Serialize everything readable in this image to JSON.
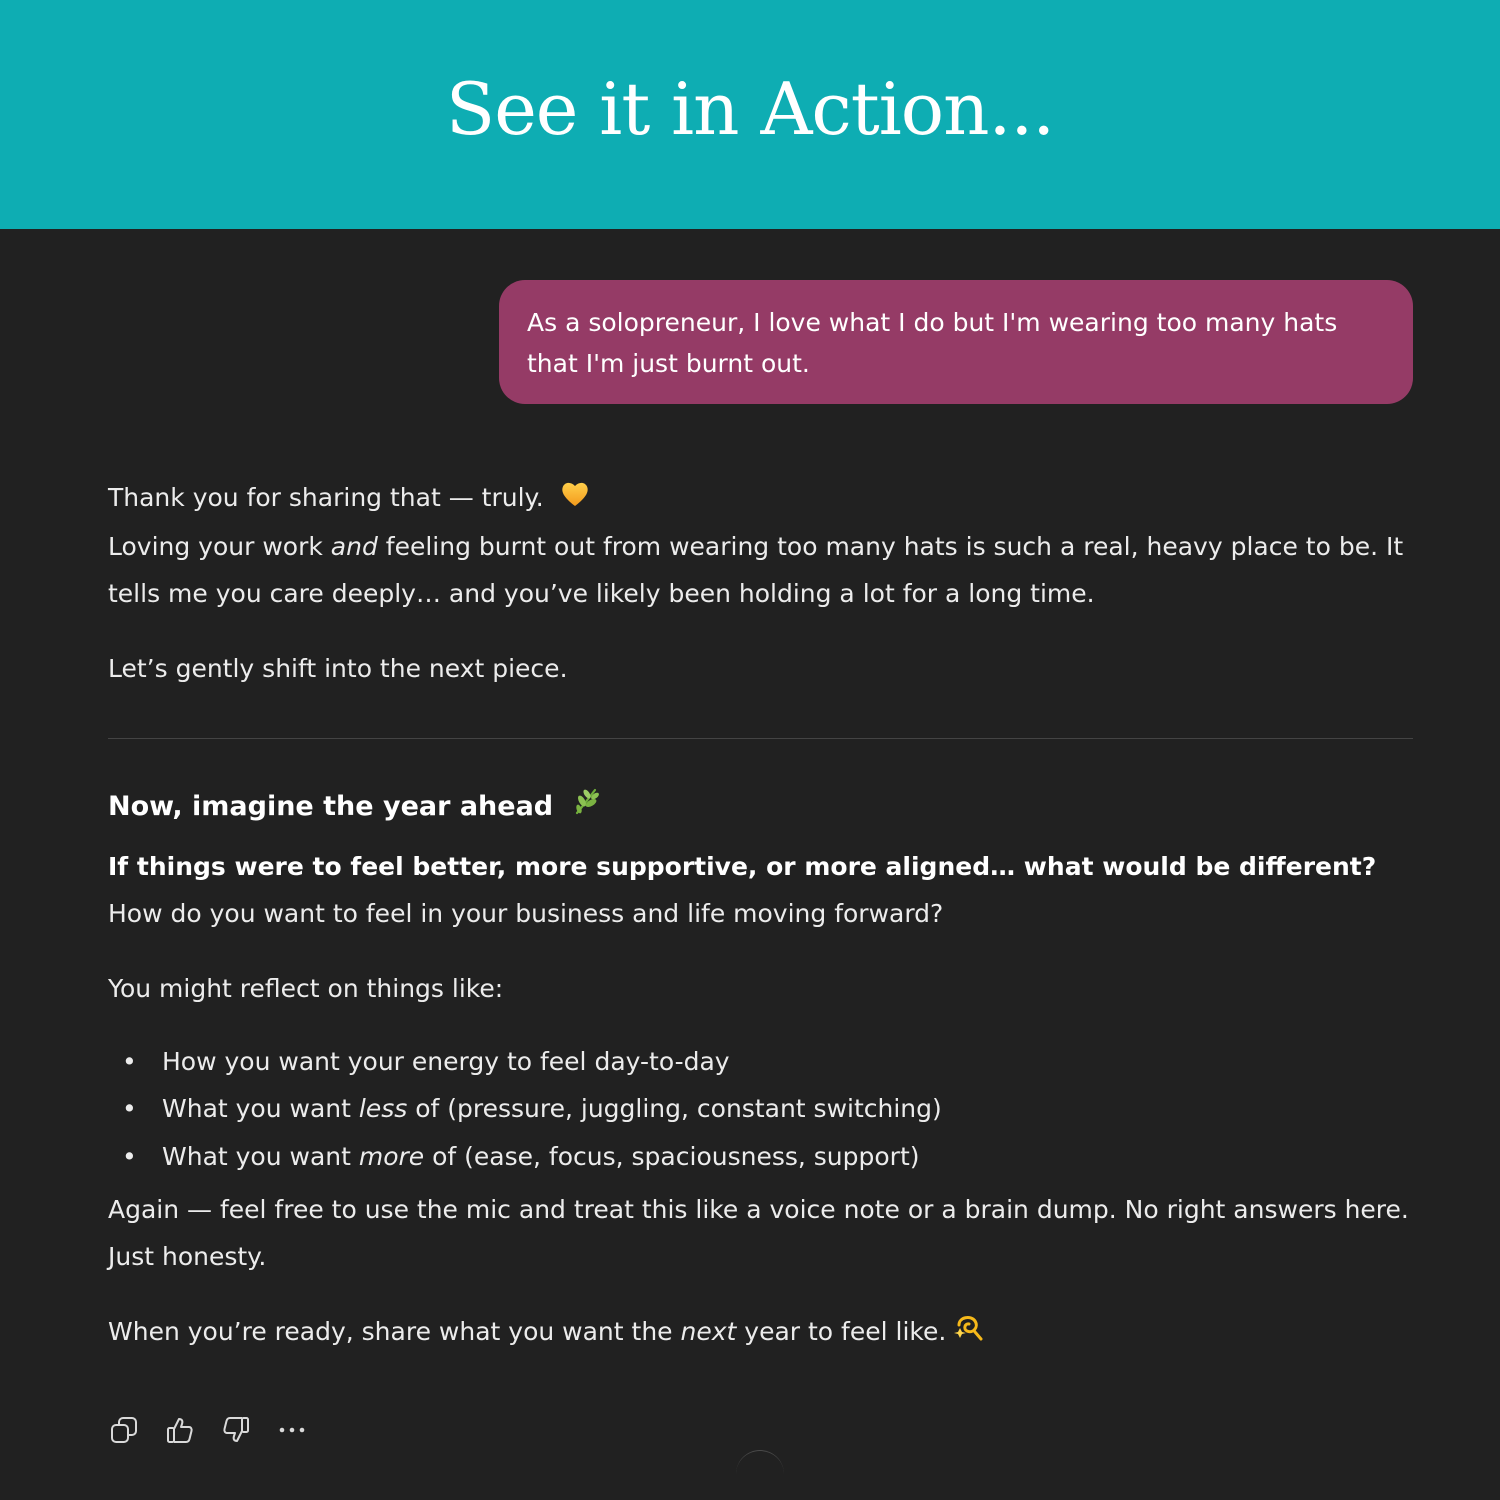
{
  "banner": {
    "title": "See it in Action..."
  },
  "user_message": {
    "text": "As a solopreneur, I love what I do but I'm wearing too many hats that I'm just burnt out."
  },
  "assistant": {
    "intro_line": "Thank you for sharing that — truly.",
    "intro_emoji": "orange-heart-icon",
    "p1_a": "Loving your work ",
    "p1_em": "and",
    "p1_b": " feeling burnt out from wearing too many hats is such a real, heavy place to be. It tells me you care deeply… and you’ve likely been holding a lot for a long time.",
    "p2": "Let’s gently shift into the next piece.",
    "heading": "Now, imagine the year ahead",
    "heading_emoji": "herb-icon",
    "bold_question": "If things were to feel better, more supportive, or more aligned… what would be different?",
    "question": "How do you want to feel in your business and life moving forward?",
    "reflect_intro": "You might reflect on things like:",
    "bullets": [
      {
        "a": "How you want your energy to feel day-to-day",
        "em": "",
        "b": ""
      },
      {
        "a": "What you want ",
        "em": "less",
        "b": " of (pressure, juggling, constant switching)"
      },
      {
        "a": "What you want ",
        "em": "more",
        "b": " of (ease, focus, spaciousness, support)"
      }
    ],
    "again": "Again — feel free to use the mic and treat this like a voice note or a brain dump. No right answers here. Just honesty.",
    "closing_a": "When you’re ready, share what you want the ",
    "closing_em": "next",
    "closing_b": " year to feel like.",
    "closing_emoji": "dizzy-icon"
  },
  "actions": [
    "copy-icon",
    "thumbs-up-icon",
    "thumbs-down-icon",
    "more-icon"
  ],
  "colors": {
    "banner": "#0eadb3",
    "background": "#212121",
    "user_bubble": "#953b66",
    "text": "#ececec"
  }
}
